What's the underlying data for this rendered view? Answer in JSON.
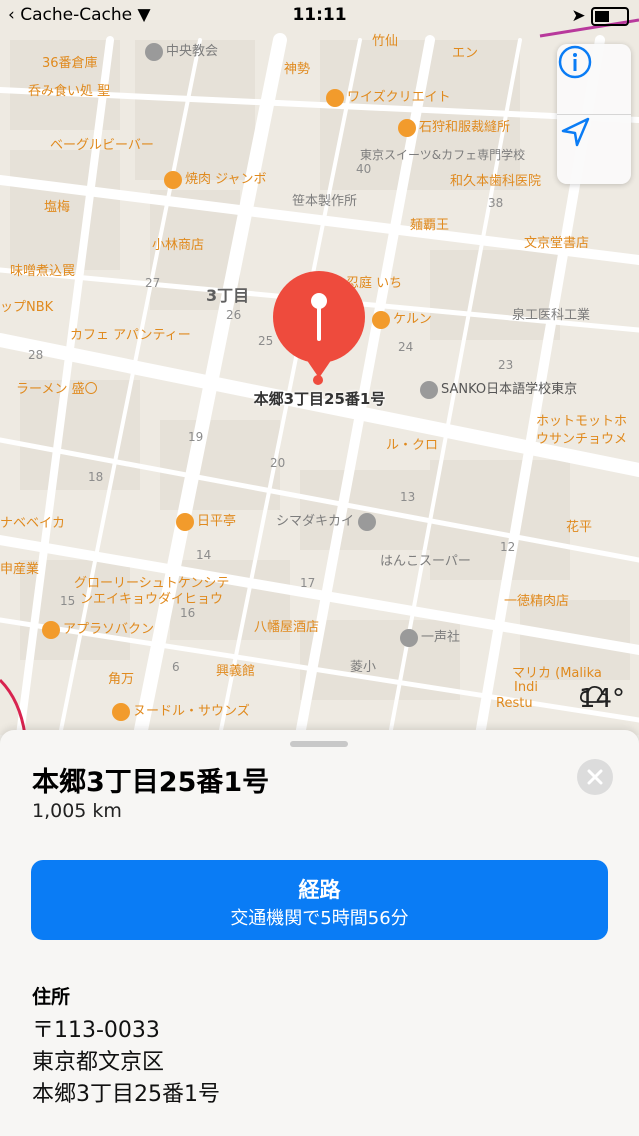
{
  "status_bar": {
    "back_app": "Cache-Cache",
    "time": "11:11"
  },
  "map": {
    "district": "3丁目",
    "pin_label": "本郷3丁目25番1号",
    "weather_temp": "14°",
    "pois": [
      "中央教会",
      "竹仙",
      "エン",
      "36番倉庫",
      "神勢",
      "呑み食い処 聖",
      "ワイズクリエイト",
      "ベーグルビーバー",
      "石狩和服裁縫所",
      "東京スイーツ&カフェ専門学校",
      "焼肉 ジャンボ",
      "和久本歯科医院",
      "塩梅",
      "笹本製作所",
      "麺覇王",
      "小林商店",
      "文京堂書店",
      "味噌煮込罠",
      "ップNBK",
      "忍庭 いち",
      "ケルン",
      "泉工医科工業",
      "カフェ アパンティー",
      "ラーメン 盛〇",
      "SANKO日本語学校東京",
      "ホットモットホ",
      "ウサンチョウメ",
      "ル・クロ",
      "ナベベイカ",
      "日平亭",
      "シマダキカイ",
      "花平",
      "申産業",
      "はんこスーパー",
      "グローリーシュトケンシテ",
      "ンエイキョウダイヒョウ",
      "一徳精肉店",
      "八幡屋酒店",
      "アプラソバクン",
      "一声社",
      "角万",
      "興義館",
      "菱小",
      "マリカ (Malika",
      "Indi",
      "Restu",
      "ヌードル・サウンズ"
    ],
    "building_numbers": [
      "26",
      "27",
      "28",
      "40",
      "38",
      "23",
      "24",
      "25",
      "19",
      "20",
      "18",
      "14",
      "15",
      "12",
      "13",
      "17",
      "16",
      "6"
    ]
  },
  "sheet": {
    "title": "本郷3丁目25番1号",
    "distance": "1,005 km",
    "route_button": {
      "label": "経路",
      "sublabel": "交通機関で5時間56分"
    },
    "address_heading": "住所",
    "address_lines": [
      "〒113-0033",
      "東京都文京区",
      "本郷3丁目25番1号"
    ]
  },
  "colors": {
    "accent": "#0a7cf5",
    "pin": "#ee4b3d",
    "poi": "#e08a1e"
  }
}
